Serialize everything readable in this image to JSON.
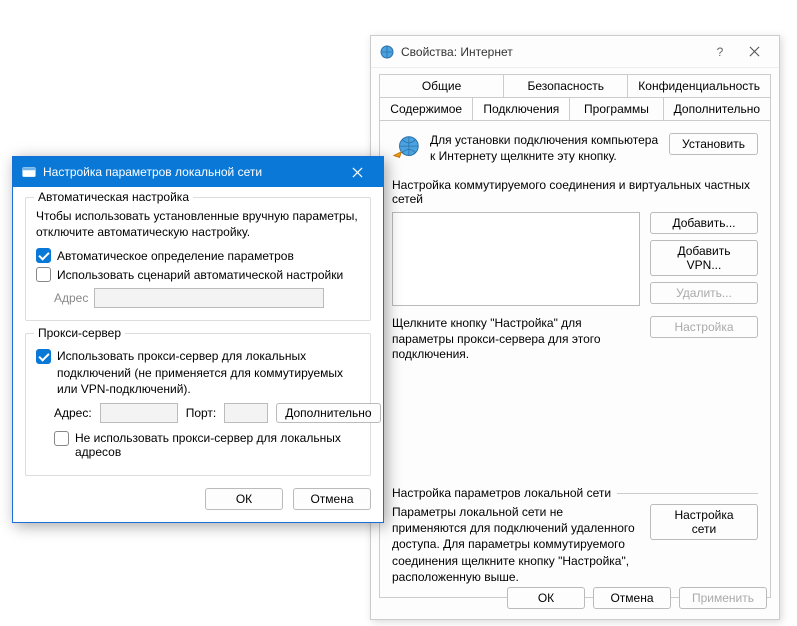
{
  "inet": {
    "title": "Свойства: Интернет",
    "help": "?",
    "tabsRow1": [
      "Общие",
      "Безопасность",
      "Конфиденциальность"
    ],
    "tabsRow2": [
      "Содержимое",
      "Подключения",
      "Программы",
      "Дополнительно"
    ],
    "activeTab": "Подключения",
    "setupText": "Для установки подключения компьютера к Интернету щелкните эту кнопку.",
    "setupBtn": "Установить",
    "dialSection": "Настройка коммутируемого соединения и виртуальных частных сетей",
    "addBtn": "Добавить...",
    "addVpnBtn": "Добавить VPN...",
    "deleteBtn": "Удалить...",
    "settingsBtn": "Настройка",
    "dialHint": "Щелкните кнопку \"Настройка\" для параметры прокси-сервера для этого подключения.",
    "lanSection": "Настройка параметров локальной сети",
    "lanText": "Параметры локальной сети не применяются для подключений удаленного доступа. Для параметры коммутируемого соединения щелкните кнопку \"Настройка\", расположенную выше.",
    "lanBtn": "Настройка сети",
    "ok": "ОК",
    "cancel": "Отмена",
    "apply": "Применить"
  },
  "lan": {
    "title": "Настройка параметров локальной сети",
    "autoGroup": "Автоматическая настройка",
    "autoInfo": "Чтобы использовать установленные вручную параметры, отключите автоматическую настройку.",
    "autoDetect": "Автоматическое определение параметров",
    "useScript": "Использовать сценарий автоматической настройки",
    "addressLabel": "Адрес",
    "proxyGroup": "Прокси-сервер",
    "useProxy": "Использовать прокси-сервер для локальных подключений (не применяется для коммутируемых или VPN-подключений).",
    "proxyAddrLabel": "Адрес:",
    "proxyPortLabel": "Порт:",
    "advancedBtn": "Дополнительно",
    "bypassLocal": "Не использовать прокси-сервер для локальных адресов",
    "ok": "ОК",
    "cancel": "Отмена"
  }
}
